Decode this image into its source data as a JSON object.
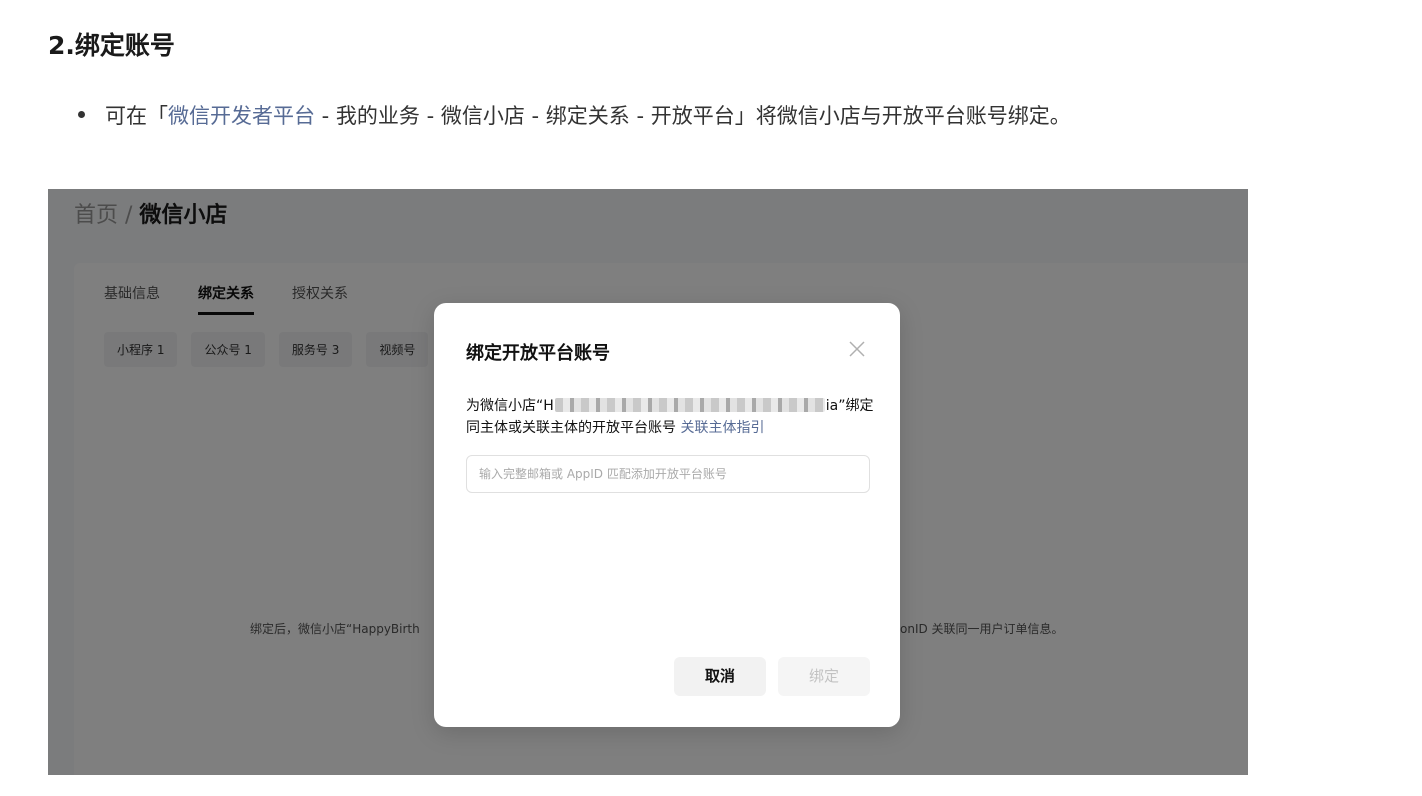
{
  "doc": {
    "heading": "2.绑定账号",
    "bullet": {
      "prefix": "可在「",
      "link": "微信开发者平台",
      "suffix": " - 我的业务 - 微信小店 - 绑定关系 - 开放平台」将微信小店与开放平台账号绑定。"
    }
  },
  "screen": {
    "breadcrumb": {
      "parent": "首页",
      "separator": " / ",
      "current": "微信小店"
    },
    "tabs": [
      "基础信息",
      "绑定关系",
      "授权关系"
    ],
    "active_tab": 1,
    "chips": [
      "小程序 1",
      "公众号 1",
      "服务号 3",
      "视频号"
    ],
    "footnote_left": "绑定后，微信小店“HappyBirth",
    "footnote_right": "onID 关联同一用户订单信息。",
    "modal": {
      "title": "绑定开放平台账号",
      "desc_prefix": "为微信小店“H",
      "desc_suffix": "ia”绑定",
      "desc_line2": "同主体或关联主体的开放平台账号 ",
      "desc_link": "关联主体指引",
      "input_placeholder": "输入完整邮箱或 AppID 匹配添加开放平台账号",
      "input_value": "",
      "cancel_label": "取消",
      "bind_label": "绑定"
    }
  },
  "colors": {
    "link": "#576b95",
    "overlay": "rgba(0,0,0,0.5)"
  },
  "icons": {
    "close": "close-icon"
  }
}
